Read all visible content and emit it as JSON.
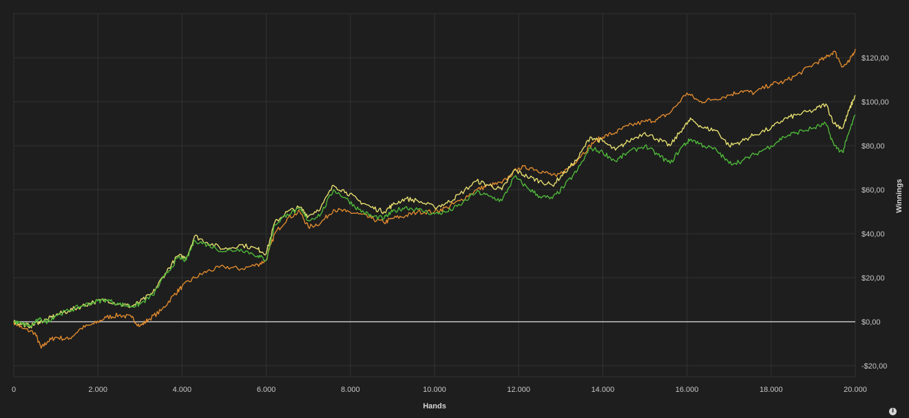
{
  "chart_data": {
    "type": "line",
    "xlabel": "Hands",
    "ylabel": "Winnings",
    "xlim": [
      0,
      20000
    ],
    "ylim": [
      -25,
      140
    ],
    "x_ticks": [
      0,
      2000,
      4000,
      6000,
      8000,
      10000,
      12000,
      14000,
      16000,
      18000,
      20000
    ],
    "x_tick_labels": [
      "0",
      "2.000",
      "4.000",
      "6.000",
      "8.000",
      "10.000",
      "12.000",
      "14.000",
      "16.000",
      "18.000",
      "20.000"
    ],
    "y_ticks": [
      -20,
      0,
      20,
      40,
      60,
      80,
      100,
      120
    ],
    "y_tick_labels": [
      "-$20,00",
      "$0,00",
      "$20,00",
      "$40,00",
      "$60,00",
      "$80,00",
      "$100,00",
      "$120,00"
    ],
    "y_axis_position": "right",
    "grid": true,
    "zero_line": true,
    "series": [
      {
        "color": "#e08a2e",
        "x": [
          0,
          200,
          500,
          650,
          800,
          1000,
          1300,
          1600,
          1900,
          2200,
          2500,
          2800,
          3000,
          3200,
          3500,
          3800,
          4000,
          4300,
          4600,
          5000,
          5400,
          5800,
          6000,
          6200,
          6500,
          6800,
          7000,
          7300,
          7600,
          7900,
          8200,
          8500,
          8800,
          9000,
          9300,
          9600,
          10000,
          10300,
          10600,
          11000,
          11300,
          11600,
          12000,
          12300,
          12600,
          12900,
          13200,
          13500,
          13800,
          14000,
          14300,
          14600,
          15000,
          15300,
          15600,
          16000,
          16300,
          16600,
          17000,
          17300,
          17600,
          18000,
          18300,
          18600,
          19000,
          19300,
          19500,
          19700,
          19850,
          20000
        ],
        "values": [
          0,
          -3,
          -5,
          -12,
          -9,
          -7,
          -8,
          -3,
          -1,
          2,
          3,
          2,
          -2,
          1,
          5,
          12,
          16,
          20,
          23,
          25,
          24,
          26,
          28,
          40,
          47,
          50,
          43,
          45,
          51,
          50,
          49,
          47,
          45,
          47,
          48,
          50,
          50,
          52,
          55,
          60,
          62,
          63,
          70,
          70,
          68,
          66,
          70,
          76,
          82,
          84,
          86,
          89,
          91,
          92,
          95,
          104,
          100,
          101,
          103,
          105,
          104,
          108,
          109,
          112,
          117,
          120,
          123,
          116,
          118,
          124
        ]
      },
      {
        "color": "#e8e070",
        "x": [
          0,
          200,
          400,
          600,
          800,
          1000,
          1300,
          1600,
          1900,
          2200,
          2500,
          2800,
          3000,
          3300,
          3600,
          3900,
          4100,
          4300,
          4600,
          5000,
          5400,
          5800,
          6000,
          6200,
          6500,
          6800,
          7000,
          7300,
          7600,
          7900,
          8200,
          8500,
          8800,
          9000,
          9300,
          9600,
          10000,
          10300,
          10600,
          11000,
          11300,
          11600,
          11900,
          12200,
          12500,
          12800,
          13100,
          13400,
          13700,
          14000,
          14300,
          14600,
          15000,
          15300,
          15600,
          15900,
          16100,
          16400,
          16700,
          17000,
          17300,
          17600,
          18000,
          18300,
          18600,
          19000,
          19300,
          19500,
          19700,
          19850,
          20000
        ],
        "values": [
          0,
          -1,
          -2,
          0,
          1,
          3,
          5,
          7,
          9,
          10,
          8,
          7,
          9,
          13,
          22,
          30,
          29,
          39,
          36,
          33,
          35,
          33,
          31,
          45,
          50,
          52,
          48,
          52,
          62,
          59,
          55,
          52,
          50,
          53,
          56,
          55,
          52,
          54,
          58,
          64,
          62,
          60,
          69,
          66,
          64,
          62,
          68,
          74,
          84,
          82,
          78,
          82,
          86,
          83,
          80,
          88,
          92,
          88,
          87,
          80,
          82,
          85,
          88,
          92,
          94,
          96,
          99,
          90,
          88,
          96,
          103
        ]
      },
      {
        "color": "#4fb83a",
        "x": [
          0,
          200,
          400,
          600,
          800,
          1000,
          1300,
          1600,
          1900,
          2200,
          2500,
          2800,
          3000,
          3300,
          3600,
          3900,
          4100,
          4300,
          4600,
          5000,
          5400,
          5800,
          6000,
          6200,
          6500,
          6800,
          7000,
          7300,
          7600,
          7900,
          8200,
          8500,
          8800,
          9000,
          9300,
          9600,
          10000,
          10300,
          10600,
          11000,
          11300,
          11600,
          11900,
          12200,
          12500,
          12800,
          13100,
          13400,
          13700,
          14000,
          14300,
          14600,
          15000,
          15300,
          15600,
          15900,
          16100,
          16400,
          16700,
          17000,
          17300,
          17600,
          18000,
          18300,
          18600,
          19000,
          19300,
          19500,
          19700,
          19850,
          20000
        ],
        "values": [
          0,
          -1,
          -2,
          1,
          0,
          3,
          5,
          7,
          9,
          10,
          8,
          7,
          8,
          12,
          21,
          29,
          28,
          37,
          35,
          32,
          33,
          30,
          28,
          44,
          49,
          51,
          46,
          49,
          60,
          56,
          51,
          48,
          47,
          50,
          52,
          51,
          49,
          50,
          53,
          59,
          57,
          55,
          66,
          61,
          57,
          56,
          62,
          69,
          79,
          77,
          73,
          77,
          80,
          76,
          72,
          80,
          83,
          80,
          78,
          72,
          73,
          76,
          80,
          84,
          86,
          88,
          90,
          80,
          77,
          86,
          94
        ]
      }
    ]
  },
  "info_icon": "info-icon",
  "info_symbol": "i"
}
